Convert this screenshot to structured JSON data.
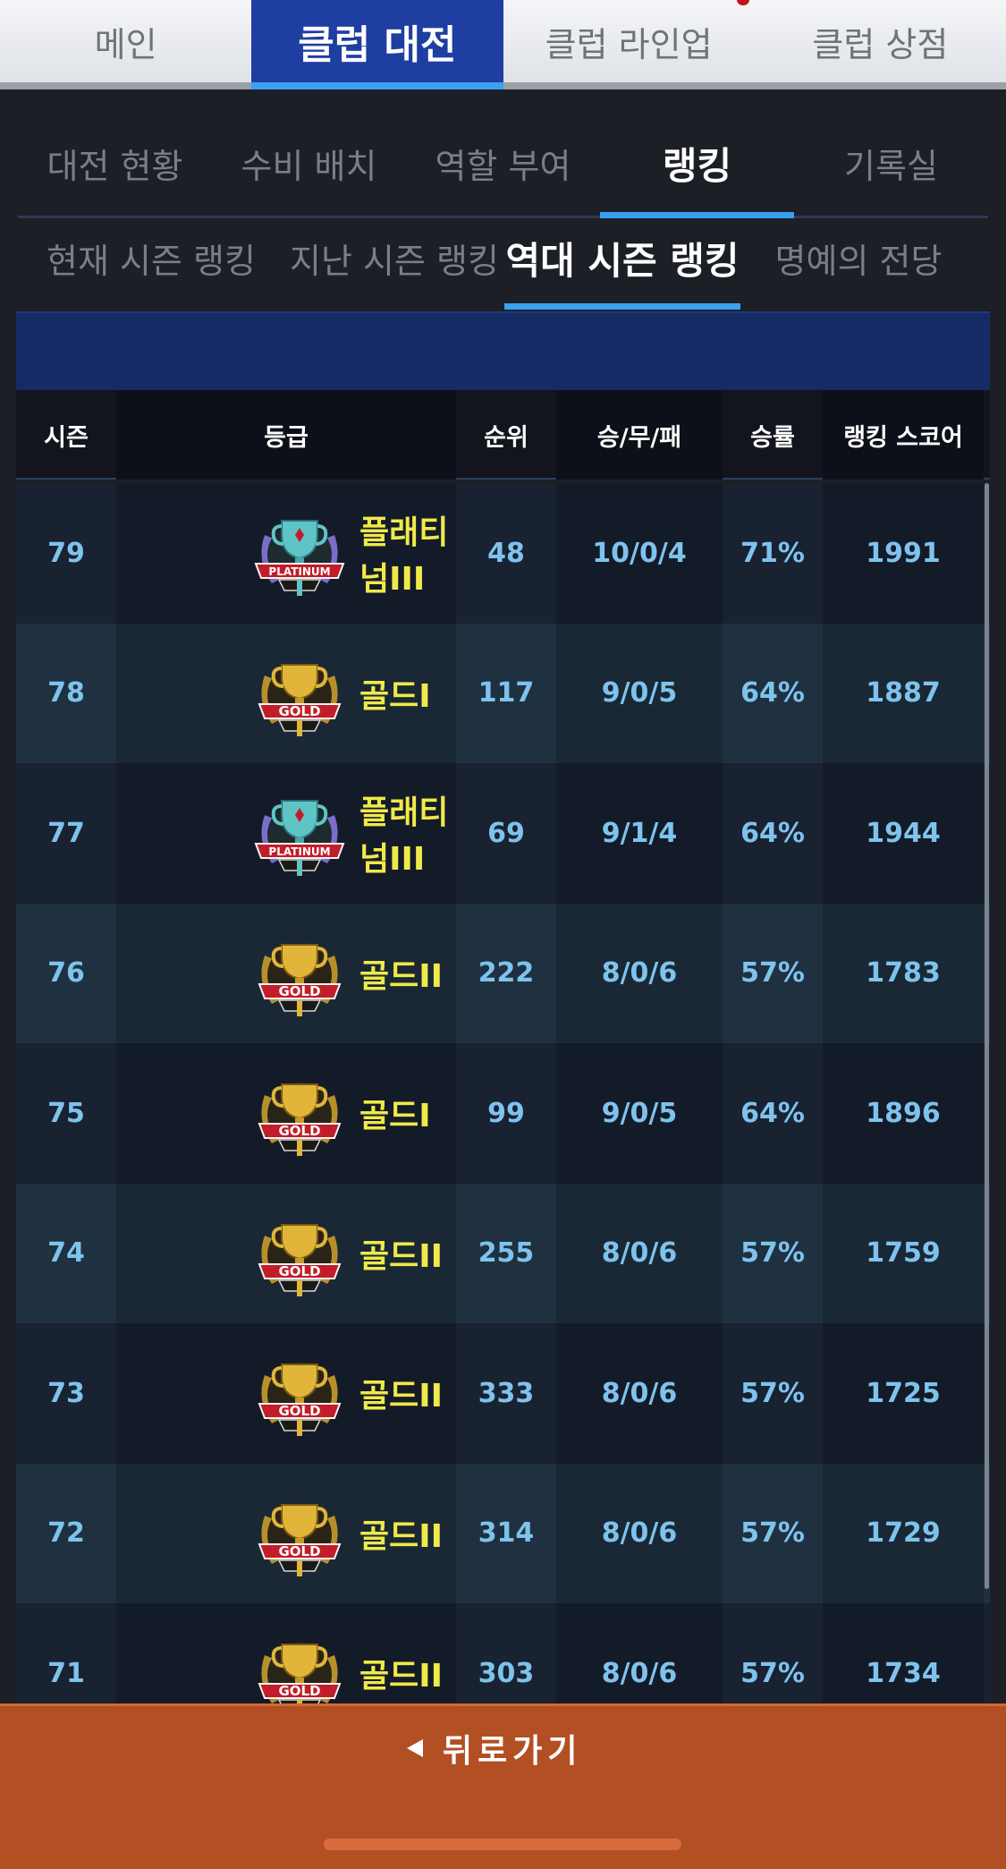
{
  "top_tabs": [
    "메인",
    "클럽 대전",
    "클럽 라인업",
    "클럽 상점"
  ],
  "sub_tabs": [
    "대전 현황",
    "수비 배치",
    "역할 부여",
    "랭킹",
    "기록실"
  ],
  "season_tabs": [
    "현재 시즌 랭킹",
    "지난 시즌 랭킹",
    "역대 시즌 랭킹",
    "명예의 전당"
  ],
  "table": {
    "headers": [
      "시즌",
      "등급",
      "순위",
      "승/무/패",
      "승률",
      "랭킹 스코어"
    ],
    "rows": [
      {
        "season": "79",
        "badge": "platinum-badge-icon",
        "grade": "플래티넘III",
        "rank": "48",
        "wdl": "10/0/4",
        "rate": "71%",
        "score": "1991"
      },
      {
        "season": "78",
        "badge": "gold-badge-icon",
        "grade": "골드I",
        "rank": "117",
        "wdl": "9/0/5",
        "rate": "64%",
        "score": "1887"
      },
      {
        "season": "77",
        "badge": "platinum-badge-icon",
        "grade": "플래티넘III",
        "rank": "69",
        "wdl": "9/1/4",
        "rate": "64%",
        "score": "1944"
      },
      {
        "season": "76",
        "badge": "gold-badge-icon",
        "grade": "골드II",
        "rank": "222",
        "wdl": "8/0/6",
        "rate": "57%",
        "score": "1783"
      },
      {
        "season": "75",
        "badge": "gold-badge-icon",
        "grade": "골드I",
        "rank": "99",
        "wdl": "9/0/5",
        "rate": "64%",
        "score": "1896"
      },
      {
        "season": "74",
        "badge": "gold-badge-icon",
        "grade": "골드II",
        "rank": "255",
        "wdl": "8/0/6",
        "rate": "57%",
        "score": "1759"
      },
      {
        "season": "73",
        "badge": "gold-badge-icon",
        "grade": "골드II",
        "rank": "333",
        "wdl": "8/0/6",
        "rate": "57%",
        "score": "1725"
      },
      {
        "season": "72",
        "badge": "gold-badge-icon",
        "grade": "골드II",
        "rank": "314",
        "wdl": "8/0/6",
        "rate": "57%",
        "score": "1729"
      },
      {
        "season": "71",
        "badge": "gold-badge-icon",
        "grade": "골드II",
        "rank": "303",
        "wdl": "8/0/6",
        "rate": "57%",
        "score": "1734"
      }
    ]
  },
  "back_button": "뒤로가기",
  "colors": {
    "accent": "#3aa0f0",
    "active_tab": "#1f3ea2",
    "grade_text": "#f0e94a",
    "value_text": "#7ec3ee",
    "back_bar": "#b24f23"
  }
}
